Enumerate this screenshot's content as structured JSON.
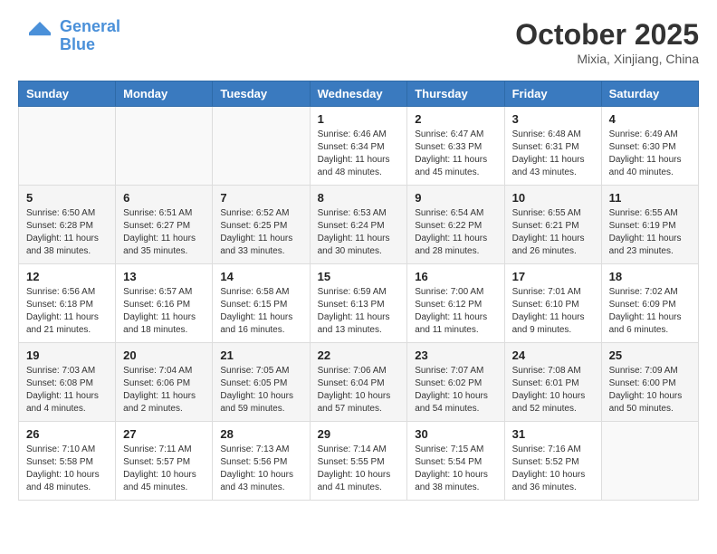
{
  "header": {
    "logo_line1": "General",
    "logo_line2": "Blue",
    "month_title": "October 2025",
    "location": "Mixia, Xinjiang, China"
  },
  "weekdays": [
    "Sunday",
    "Monday",
    "Tuesday",
    "Wednesday",
    "Thursday",
    "Friday",
    "Saturday"
  ],
  "weeks": [
    [
      {
        "day": "",
        "info": ""
      },
      {
        "day": "",
        "info": ""
      },
      {
        "day": "",
        "info": ""
      },
      {
        "day": "1",
        "info": "Sunrise: 6:46 AM\nSunset: 6:34 PM\nDaylight: 11 hours\nand 48 minutes."
      },
      {
        "day": "2",
        "info": "Sunrise: 6:47 AM\nSunset: 6:33 PM\nDaylight: 11 hours\nand 45 minutes."
      },
      {
        "day": "3",
        "info": "Sunrise: 6:48 AM\nSunset: 6:31 PM\nDaylight: 11 hours\nand 43 minutes."
      },
      {
        "day": "4",
        "info": "Sunrise: 6:49 AM\nSunset: 6:30 PM\nDaylight: 11 hours\nand 40 minutes."
      }
    ],
    [
      {
        "day": "5",
        "info": "Sunrise: 6:50 AM\nSunset: 6:28 PM\nDaylight: 11 hours\nand 38 minutes."
      },
      {
        "day": "6",
        "info": "Sunrise: 6:51 AM\nSunset: 6:27 PM\nDaylight: 11 hours\nand 35 minutes."
      },
      {
        "day": "7",
        "info": "Sunrise: 6:52 AM\nSunset: 6:25 PM\nDaylight: 11 hours\nand 33 minutes."
      },
      {
        "day": "8",
        "info": "Sunrise: 6:53 AM\nSunset: 6:24 PM\nDaylight: 11 hours\nand 30 minutes."
      },
      {
        "day": "9",
        "info": "Sunrise: 6:54 AM\nSunset: 6:22 PM\nDaylight: 11 hours\nand 28 minutes."
      },
      {
        "day": "10",
        "info": "Sunrise: 6:55 AM\nSunset: 6:21 PM\nDaylight: 11 hours\nand 26 minutes."
      },
      {
        "day": "11",
        "info": "Sunrise: 6:55 AM\nSunset: 6:19 PM\nDaylight: 11 hours\nand 23 minutes."
      }
    ],
    [
      {
        "day": "12",
        "info": "Sunrise: 6:56 AM\nSunset: 6:18 PM\nDaylight: 11 hours\nand 21 minutes."
      },
      {
        "day": "13",
        "info": "Sunrise: 6:57 AM\nSunset: 6:16 PM\nDaylight: 11 hours\nand 18 minutes."
      },
      {
        "day": "14",
        "info": "Sunrise: 6:58 AM\nSunset: 6:15 PM\nDaylight: 11 hours\nand 16 minutes."
      },
      {
        "day": "15",
        "info": "Sunrise: 6:59 AM\nSunset: 6:13 PM\nDaylight: 11 hours\nand 13 minutes."
      },
      {
        "day": "16",
        "info": "Sunrise: 7:00 AM\nSunset: 6:12 PM\nDaylight: 11 hours\nand 11 minutes."
      },
      {
        "day": "17",
        "info": "Sunrise: 7:01 AM\nSunset: 6:10 PM\nDaylight: 11 hours\nand 9 minutes."
      },
      {
        "day": "18",
        "info": "Sunrise: 7:02 AM\nSunset: 6:09 PM\nDaylight: 11 hours\nand 6 minutes."
      }
    ],
    [
      {
        "day": "19",
        "info": "Sunrise: 7:03 AM\nSunset: 6:08 PM\nDaylight: 11 hours\nand 4 minutes."
      },
      {
        "day": "20",
        "info": "Sunrise: 7:04 AM\nSunset: 6:06 PM\nDaylight: 11 hours\nand 2 minutes."
      },
      {
        "day": "21",
        "info": "Sunrise: 7:05 AM\nSunset: 6:05 PM\nDaylight: 10 hours\nand 59 minutes."
      },
      {
        "day": "22",
        "info": "Sunrise: 7:06 AM\nSunset: 6:04 PM\nDaylight: 10 hours\nand 57 minutes."
      },
      {
        "day": "23",
        "info": "Sunrise: 7:07 AM\nSunset: 6:02 PM\nDaylight: 10 hours\nand 54 minutes."
      },
      {
        "day": "24",
        "info": "Sunrise: 7:08 AM\nSunset: 6:01 PM\nDaylight: 10 hours\nand 52 minutes."
      },
      {
        "day": "25",
        "info": "Sunrise: 7:09 AM\nSunset: 6:00 PM\nDaylight: 10 hours\nand 50 minutes."
      }
    ],
    [
      {
        "day": "26",
        "info": "Sunrise: 7:10 AM\nSunset: 5:58 PM\nDaylight: 10 hours\nand 48 minutes."
      },
      {
        "day": "27",
        "info": "Sunrise: 7:11 AM\nSunset: 5:57 PM\nDaylight: 10 hours\nand 45 minutes."
      },
      {
        "day": "28",
        "info": "Sunrise: 7:13 AM\nSunset: 5:56 PM\nDaylight: 10 hours\nand 43 minutes."
      },
      {
        "day": "29",
        "info": "Sunrise: 7:14 AM\nSunset: 5:55 PM\nDaylight: 10 hours\nand 41 minutes."
      },
      {
        "day": "30",
        "info": "Sunrise: 7:15 AM\nSunset: 5:54 PM\nDaylight: 10 hours\nand 38 minutes."
      },
      {
        "day": "31",
        "info": "Sunrise: 7:16 AM\nSunset: 5:52 PM\nDaylight: 10 hours\nand 36 minutes."
      },
      {
        "day": "",
        "info": ""
      }
    ]
  ]
}
